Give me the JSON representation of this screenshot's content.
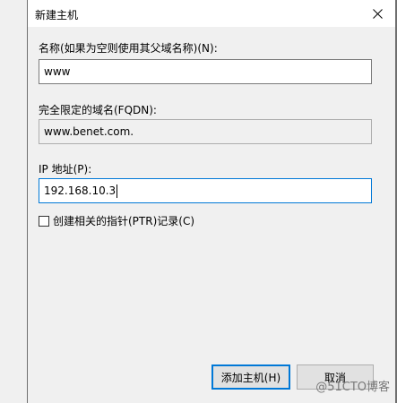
{
  "dialog": {
    "title": "新建主机"
  },
  "name_field": {
    "label": "名称(如果为空则使用其父域名称)(N):",
    "value": "www"
  },
  "fqdn_field": {
    "label": "完全限定的域名(FQDN):",
    "value": "www.benet.com."
  },
  "ip_field": {
    "label": "IP 地址(P):",
    "value": "192.168.10.3"
  },
  "ptr_checkbox": {
    "label": "创建相关的指针(PTR)记录(C)",
    "checked": false
  },
  "buttons": {
    "add_host": "添加主机(H)",
    "cancel": "取消"
  },
  "watermark": "@51CTO博客",
  "colors": {
    "focus_border": "#0078d7",
    "dialog_bg": "#f0f0f0",
    "frame": "#6f6f6f"
  }
}
